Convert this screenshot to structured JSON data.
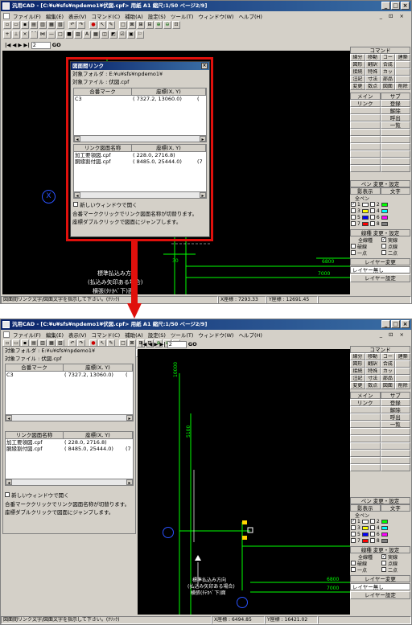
{
  "app": {
    "title": "汎用CAD - [C:¥u¥sfs¥npdemo1¥伏図.cpf> 用紙 A1 縮尺:1/50 ページ2/9]",
    "title_buttons": [
      "_",
      "□",
      "×"
    ],
    "menu": [
      "ファイル(F)",
      "編集(E)",
      "表示(V)",
      "コマンド(C)",
      "補助(A)",
      "設定(S)",
      "ツール(T)",
      "ウィンドウ(W)",
      "ヘルプ(H)"
    ],
    "mdi_buttons": "_ ⊡ ×"
  },
  "toolbar": {
    "page_number": "2",
    "go_label": "GO"
  },
  "command_panel": {
    "title": "コマンド",
    "commands": [
      "線分",
      "移動",
      "コーナー",
      "建築",
      "図形",
      "翻訳",
      "合成",
      "",
      "接続",
      "特殊",
      "カット",
      "",
      "注記",
      "寸法",
      "部品",
      "",
      "変更",
      "数点",
      "図面",
      "削除"
    ],
    "main_label": "メイン",
    "sub_label": "サブ",
    "main_items": [
      "リンク"
    ],
    "sub_items": [
      "登録",
      "解除",
      "呼出",
      "一覧"
    ]
  },
  "pen_panel": {
    "title": "ペン 変更・設定",
    "headers": [
      "影表示",
      "文字"
    ],
    "all_pens": "全ペン",
    "pens": [
      {
        "num": "1",
        "color": "#ffffff",
        "checked": true,
        "num2": "2",
        "color2": "#00ff00"
      },
      {
        "num": "3",
        "color": "#ffff00",
        "checked": false,
        "num2": "4",
        "color2": "#00ffff"
      },
      {
        "num": "5",
        "color": "#0000ff",
        "checked": false,
        "num2": "6",
        "color2": "#ff00ff"
      },
      {
        "num": "7",
        "color": "#ff0000",
        "checked": false,
        "num2": "8",
        "color2": "#808080"
      }
    ]
  },
  "linetype_panel": {
    "title": "線種 変更・設定",
    "items": [
      "全線種",
      "実線",
      "破線",
      "点線",
      "一点",
      "二点"
    ]
  },
  "layer_panel": {
    "title": "レイヤー変更",
    "selected": "レイヤー無し",
    "settings_button": "レイヤー設定"
  },
  "link_panel": {
    "dialog_title": "図面間リンク",
    "folder_line": "対象フォルダ : E:¥u¥sfs¥npdemo1¥",
    "file_line": "対象ファイル : 伏図.cpf",
    "col_mark": "合番マーク",
    "col_coord": "座標(X, Y)",
    "marks": [
      {
        "name": "C3",
        "coord": "( 7327.2, 13060.0)",
        "extra": "("
      }
    ],
    "col_drawing": "リンク図面名称",
    "drawings": [
      {
        "name": "加工要領図.cpf",
        "coord": "( 228.0, 2716.8)",
        "extra": ""
      },
      {
        "name": "胴緣割付図.cpf",
        "coord": "( 8485.0, 25444.0)",
        "extra": "(7"
      }
    ],
    "new_window": "新しいウィンドウで開く",
    "note1": "合番マーククリックでリンク図面名称が切替ります。",
    "note2": "座標ダブルクリックで図面にジャンプします。"
  },
  "status_top": {
    "hint": "図面間リンク文字/図面文字を指示して下さい。(ｸﾘｯｸ)",
    "x": "X座標 : 7293.33",
    "y": "Y座標 : 12691.45"
  },
  "status_bottom": {
    "hint": "図面間リンク文字/図面文字を指示して下さい。(ｸﾘｯｸ)",
    "x": "X座標 : 6494.85",
    "y": "Y座標 : 16421.02"
  },
  "cad_top": {
    "mark": "X",
    "label1": "標準払込み方向",
    "label2": "(払込み矢印ある場合)",
    "label3": "横張(ﾀﾃｶﾍﾞ下)面",
    "dim_30": "30",
    "dim_6800": "6800",
    "dim_7000": "7000"
  },
  "cad_bottom": {
    "dim_10000": "10000",
    "dim_5100": "5100",
    "label1": "標準払込み方向",
    "label2": "(払込み矢印ある場合)",
    "label3": "横張(ﾀﾃｶﾍﾞ下)面",
    "dim_6800": "6800",
    "dim_7000": "7000"
  }
}
